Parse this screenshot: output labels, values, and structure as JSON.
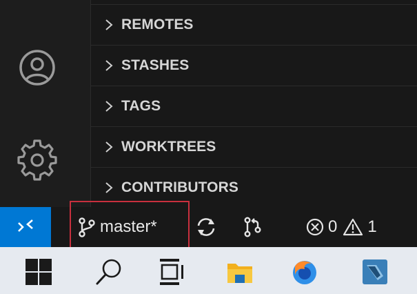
{
  "sidebar": {
    "sections": [
      {
        "label": "REMOTES",
        "icon": "chevron-right-icon"
      },
      {
        "label": "STASHES",
        "icon": "chevron-right-icon"
      },
      {
        "label": "TAGS",
        "icon": "chevron-right-icon"
      },
      {
        "label": "WORKTREES",
        "icon": "chevron-right-icon"
      },
      {
        "label": "CONTRIBUTORS",
        "icon": "chevron-right-icon"
      }
    ]
  },
  "activity_bar": {
    "items": [
      {
        "icon": "account-icon"
      },
      {
        "icon": "settings-gear-icon"
      }
    ]
  },
  "status_bar": {
    "remote_icon": "remote-icon",
    "branch": "master*",
    "branch_icon": "git-branch-icon",
    "sync_icon": "sync-icon",
    "graph_icon": "git-compare-icon",
    "errors": "0",
    "warnings": "1"
  },
  "taskbar": {
    "items": [
      {
        "icon": "windows-start-icon"
      },
      {
        "icon": "search-icon"
      },
      {
        "icon": "task-view-icon"
      },
      {
        "icon": "file-explorer-icon"
      },
      {
        "icon": "firefox-icon"
      },
      {
        "icon": "app-icon"
      }
    ]
  },
  "colors": {
    "accent": "#0078d4",
    "highlight_border": "#c9303e"
  }
}
